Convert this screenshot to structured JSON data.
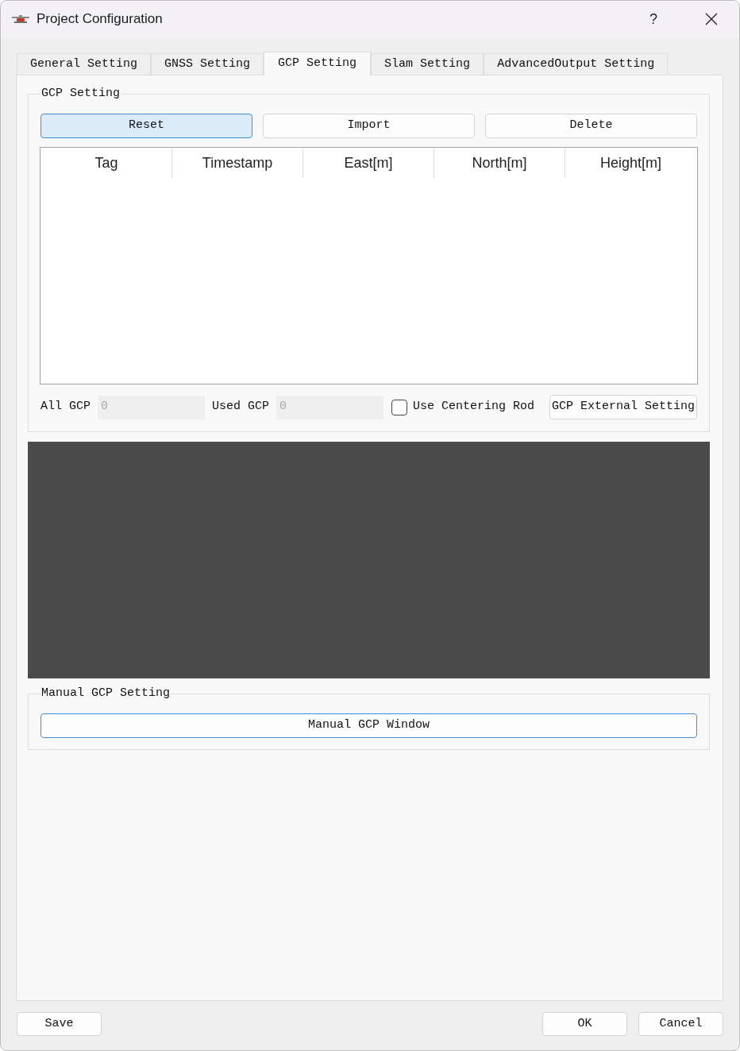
{
  "window": {
    "title": "Project Configuration",
    "help": "?"
  },
  "tabs": [
    {
      "label": "General Setting",
      "selected": false
    },
    {
      "label": "GNSS Setting",
      "selected": false
    },
    {
      "label": "GCP Setting",
      "selected": true
    },
    {
      "label": "Slam Setting",
      "selected": false
    },
    {
      "label": "AdvancedOutput Setting",
      "selected": false
    }
  ],
  "gcp_group": {
    "title": "GCP Setting",
    "buttons": [
      {
        "label": "Reset",
        "hovered": true,
        "focused": true
      },
      {
        "label": "Import",
        "hovered": false,
        "focused": false
      },
      {
        "label": "Delete",
        "hovered": false,
        "focused": false
      }
    ],
    "table": {
      "columns": [
        "Tag",
        "Timestamp",
        "East[m]",
        "North[m]",
        "Height[m]"
      ]
    },
    "counts": [
      {
        "label": "All GCP",
        "value": "0",
        "disabled": true
      },
      {
        "label": "Used GCP",
        "value": "0",
        "disabled": true
      }
    ],
    "centering_rod": {
      "label": "Use Centering Rod",
      "checked": false
    },
    "external_button": {
      "label": "GCP External Setting"
    }
  },
  "manual_group": {
    "title": "Manual GCP Setting",
    "button": {
      "label": "Manual GCP Window",
      "hovered": false,
      "focused": true
    }
  },
  "footer": {
    "left_buttons": [
      "Save"
    ],
    "right_buttons": [
      "OK",
      "Cancel"
    ]
  }
}
